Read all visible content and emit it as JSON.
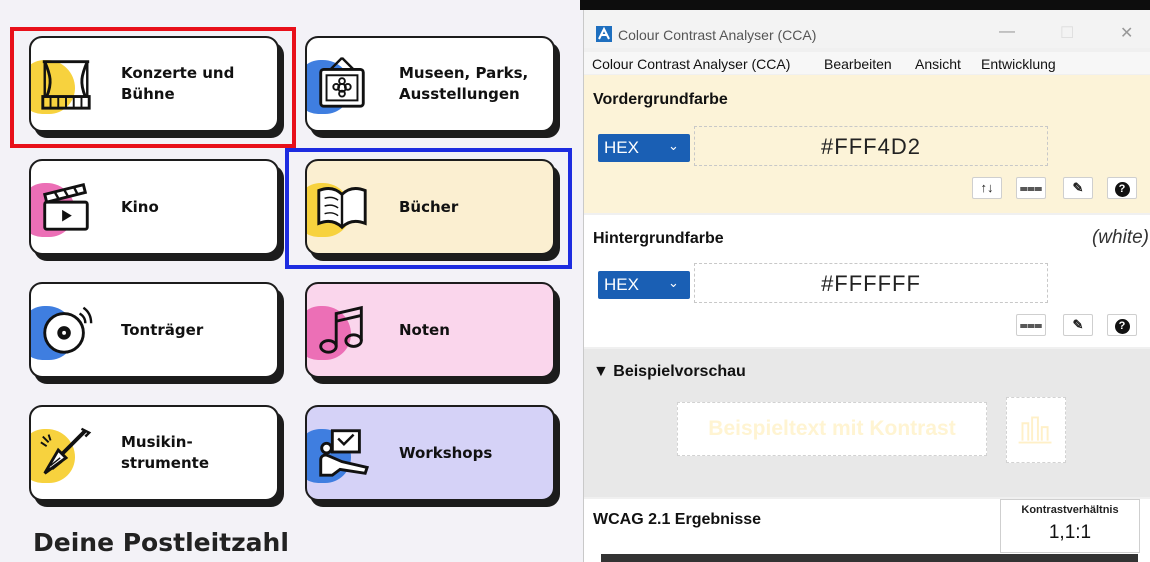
{
  "left_page": {
    "cards": [
      {
        "label": "Konzerte und\nBühne",
        "icon": "theater-stage-icon"
      },
      {
        "label": "Museen, Parks,\nAusstellungen",
        "icon": "framed-picture-icon"
      },
      {
        "label": "Kino",
        "icon": "clapperboard-icon"
      },
      {
        "label": "Bücher",
        "icon": "open-book-icon"
      },
      {
        "label": "Tonträger",
        "icon": "vinyl-record-icon"
      },
      {
        "label": "Noten",
        "icon": "music-note-icon"
      },
      {
        "label": "Musikin-\nstrumente",
        "icon": "guitar-icon"
      },
      {
        "label": "Workshops",
        "icon": "easel-icon"
      }
    ],
    "postleitzahl_heading": "Deine Postleitzahl",
    "highlight_colors": {
      "red": "#e8101a",
      "blue": "#1d2ce0"
    },
    "card_colors": {
      "yellow": "#f7d23e",
      "blue": "#3f7ee0",
      "pink": "#ec6fb6",
      "books_bg": "#fbefd1",
      "noten_bg": "#fad6ec",
      "workshops_bg": "#d5d2f7"
    }
  },
  "app": {
    "title": "Colour Contrast Analyser (CCA)",
    "window_buttons": {
      "minimize": "—",
      "maximize": "☐",
      "close": "✕"
    },
    "menu": [
      "Colour Contrast Analyser (CCA)",
      "Bearbeiten",
      "Ansicht",
      "Entwicklung"
    ],
    "foreground": {
      "title": "Vordergrundfarbe",
      "format": "HEX",
      "value": "#FFF4D2",
      "tools": [
        "↑↓",
        "⩶",
        "✎",
        "?"
      ]
    },
    "background": {
      "title": "Hintergrundfarbe",
      "color_name": "(white)",
      "format": "HEX",
      "value": "#FFFFFF",
      "tools": [
        "⩶",
        "✎",
        "?"
      ]
    },
    "preview": {
      "title": "▼ Beispielvorschau",
      "sample_text": "Beispieltext mit Kontrast"
    },
    "wcag": {
      "title": "WCAG 2.1 Ergebnisse",
      "ratio_label": "Kontrastverhältnis",
      "ratio_value": "1,1:1"
    },
    "colors": {
      "accent": "#1a5fb4",
      "fg_panel": "#fcf3d8",
      "preview_text": "#fff4d2"
    }
  }
}
